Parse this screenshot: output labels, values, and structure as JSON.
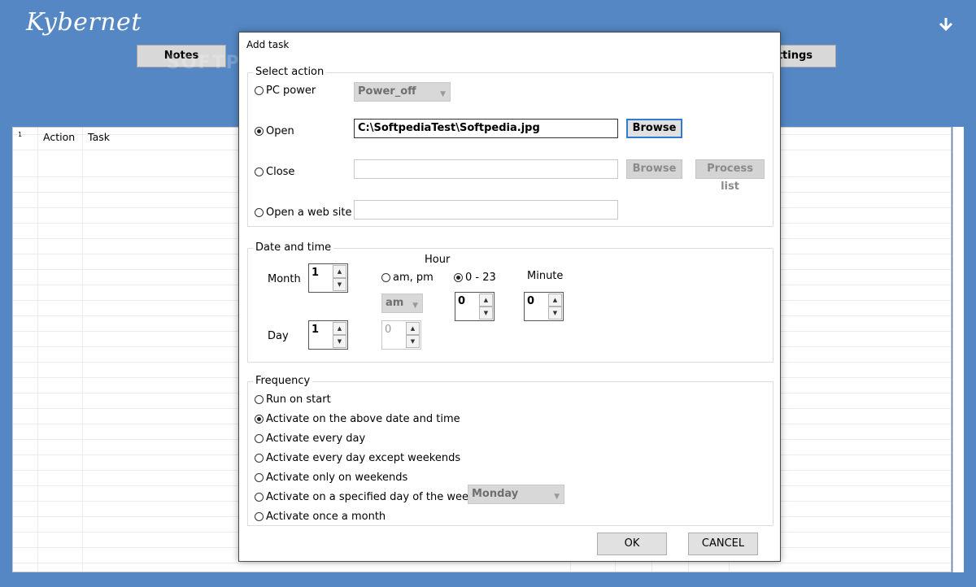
{
  "app": {
    "title": "Kybernet"
  },
  "topbar": {
    "notes_label": "Notes",
    "settings_label": "ettings"
  },
  "watermark": "SOFTPEDIA",
  "grid": {
    "corner": "1",
    "col_action": "Action",
    "col_task": "Task"
  },
  "dialog": {
    "title": "Add task",
    "select_action": {
      "legend": "Select action",
      "pc_power_label": "PC power",
      "pc_power_combo": "Power_off",
      "open_label": "Open",
      "open_path": "C:\\SoftpediaTest\\Softpedia.jpg",
      "browse_label": "Browse",
      "close_label": "Close",
      "close_browse_label": "Browse",
      "process_list_label": "Process list",
      "web_label": "Open a web site"
    },
    "date_time": {
      "legend": "Date and time",
      "month_label": "Month",
      "month_value": "1",
      "day_label": "Day",
      "day_value": "1",
      "hour_label": "Hour",
      "ampm_label": "am, pm",
      "h24_label": "0 - 23",
      "ampm_combo": "am",
      "hour12_value": "0",
      "hour24_value": "0",
      "minute_label": "Minute",
      "minute_value": "0"
    },
    "frequency": {
      "legend": "Frequency",
      "options": [
        "Run on start",
        "Activate on the above date and time",
        "Activate every day",
        "Activate every day except weekends",
        "Activate only on weekends",
        "Activate on a specified day of the week",
        "Activate once a month"
      ],
      "weekday_combo": "Monday"
    },
    "ok_label": "OK",
    "cancel_label": "CANCEL"
  }
}
